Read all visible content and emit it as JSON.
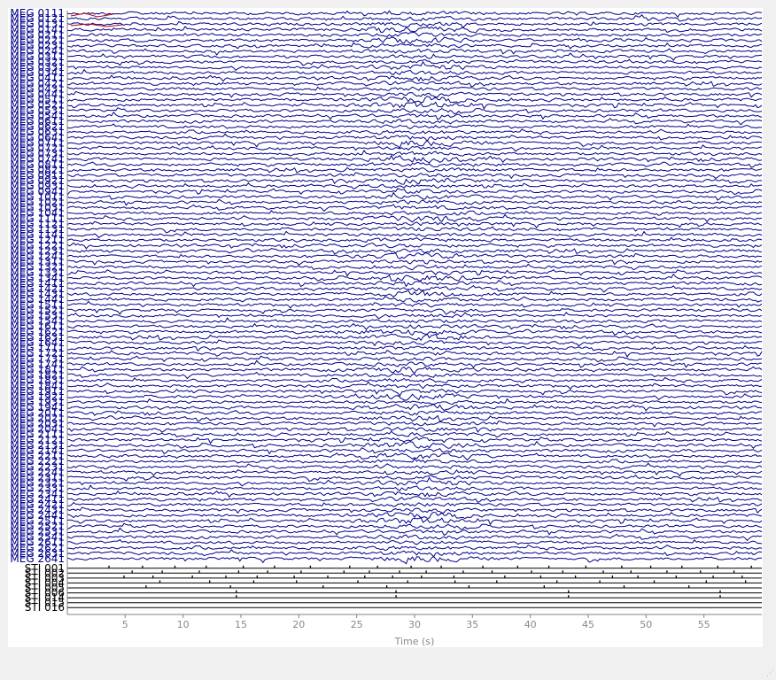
{
  "chart_data": {
    "type": "line",
    "title": "",
    "xlabel": "Time (s)",
    "ylabel": "",
    "xlim": [
      0,
      60
    ],
    "xticks": [
      5,
      10,
      15,
      20,
      25,
      30,
      35,
      40,
      45,
      50,
      55
    ],
    "grid": false,
    "legend": "none",
    "meg_channel_labels": [
      "MEG 0111",
      "MEG 0121",
      "MEG 0131",
      "MEG 0141",
      "MEG 0211",
      "MEG 0221",
      "MEG 0231",
      "MEG 0241",
      "MEG 0311",
      "MEG 0321",
      "MEG 0331",
      "MEG 0341",
      "MEG 0411",
      "MEG 0421",
      "MEG 0431",
      "MEG 0441",
      "MEG 0511",
      "MEG 0521",
      "MEG 0531",
      "MEG 0541",
      "MEG 0611",
      "MEG 0621",
      "MEG 0631",
      "MEG 0641",
      "MEG 0711",
      "MEG 0721",
      "MEG 0731",
      "MEG 0741",
      "MEG 0811",
      "MEG 0821",
      "MEG 0911",
      "MEG 0921",
      "MEG 0931",
      "MEG 0941",
      "MEG 1011",
      "MEG 1021",
      "MEG 1031",
      "MEG 1041",
      "MEG 1111",
      "MEG 1121",
      "MEG 1131",
      "MEG 1141",
      "MEG 1211",
      "MEG 1221",
      "MEG 1231",
      "MEG 1241",
      "MEG 1311",
      "MEG 1321",
      "MEG 1331",
      "MEG 1341",
      "MEG 1411",
      "MEG 1421",
      "MEG 1431",
      "MEG 1441",
      "MEG 1511",
      "MEG 1521",
      "MEG 1531",
      "MEG 1541",
      "MEG 1611",
      "MEG 1621",
      "MEG 1631",
      "MEG 1641",
      "MEG 1711",
      "MEG 1721",
      "MEG 1731",
      "MEG 1741",
      "MEG 1811",
      "MEG 1821",
      "MEG 1831",
      "MEG 1841",
      "MEG 1911",
      "MEG 1921",
      "MEG 1931",
      "MEG 1941",
      "MEG 2011",
      "MEG 2021",
      "MEG 2031",
      "MEG 2041",
      "MEG 2111",
      "MEG 2121",
      "MEG 2131",
      "MEG 2141",
      "MEG 2211",
      "MEG 2221",
      "MEG 2231",
      "MEG 2241",
      "MEG 2311",
      "MEG 2321",
      "MEG 2331",
      "MEG 2341",
      "MEG 2411",
      "MEG 2421",
      "MEG 2431",
      "MEG 2441",
      "MEG 2511",
      "MEG 2521",
      "MEG 2531",
      "MEG 2541",
      "MEG 2611",
      "MEG 2621",
      "MEG 2631",
      "MEG 2641"
    ],
    "stim_channel_labels": [
      "STI 001",
      "STI 002",
      "STI 003",
      "STI 004",
      "STI 005",
      "STI 006",
      "STI 014",
      "STI 015",
      "STI 016"
    ],
    "stim_events": [
      [
        3.6,
        6.5,
        9.3,
        12.0,
        15.2,
        17.9,
        21.0,
        24.4,
        26.8,
        29.7,
        32.3,
        35.9,
        38.9,
        41.6,
        44.8,
        47.9,
        50.4,
        53.1,
        56.2,
        59.1
      ],
      [
        5.6,
        8.2,
        11.4,
        14.8,
        17.3,
        20.2,
        23.9,
        26.1,
        28.7,
        31.0,
        34.2,
        36.7,
        40.1,
        42.8,
        46.3,
        48.7,
        51.8,
        54.7,
        57.6
      ],
      [
        4.9,
        7.4,
        10.8,
        13.7,
        16.4,
        19.6,
        22.5,
        25.7,
        28.1,
        30.6,
        33.4,
        37.8,
        40.9,
        43.9,
        47.1,
        49.3,
        52.6,
        55.8,
        58.3
      ],
      [
        8.0,
        12.3,
        16.1,
        19.8,
        25.1,
        29.4,
        33.5,
        37.1,
        42.3,
        46.0,
        50.7,
        55.2,
        58.6
      ],
      [
        6.8,
        14.1,
        22.1,
        27.6,
        34.7,
        41.2,
        48.1,
        53.7
      ],
      [
        14.6,
        28.4,
        43.3,
        56.4
      ],
      [
        14.6,
        28.4,
        43.3,
        56.4
      ],
      [],
      []
    ],
    "channel_trace_color": "#00008b",
    "event_marker_color": "#000000",
    "annotation_color": "#c00000"
  }
}
